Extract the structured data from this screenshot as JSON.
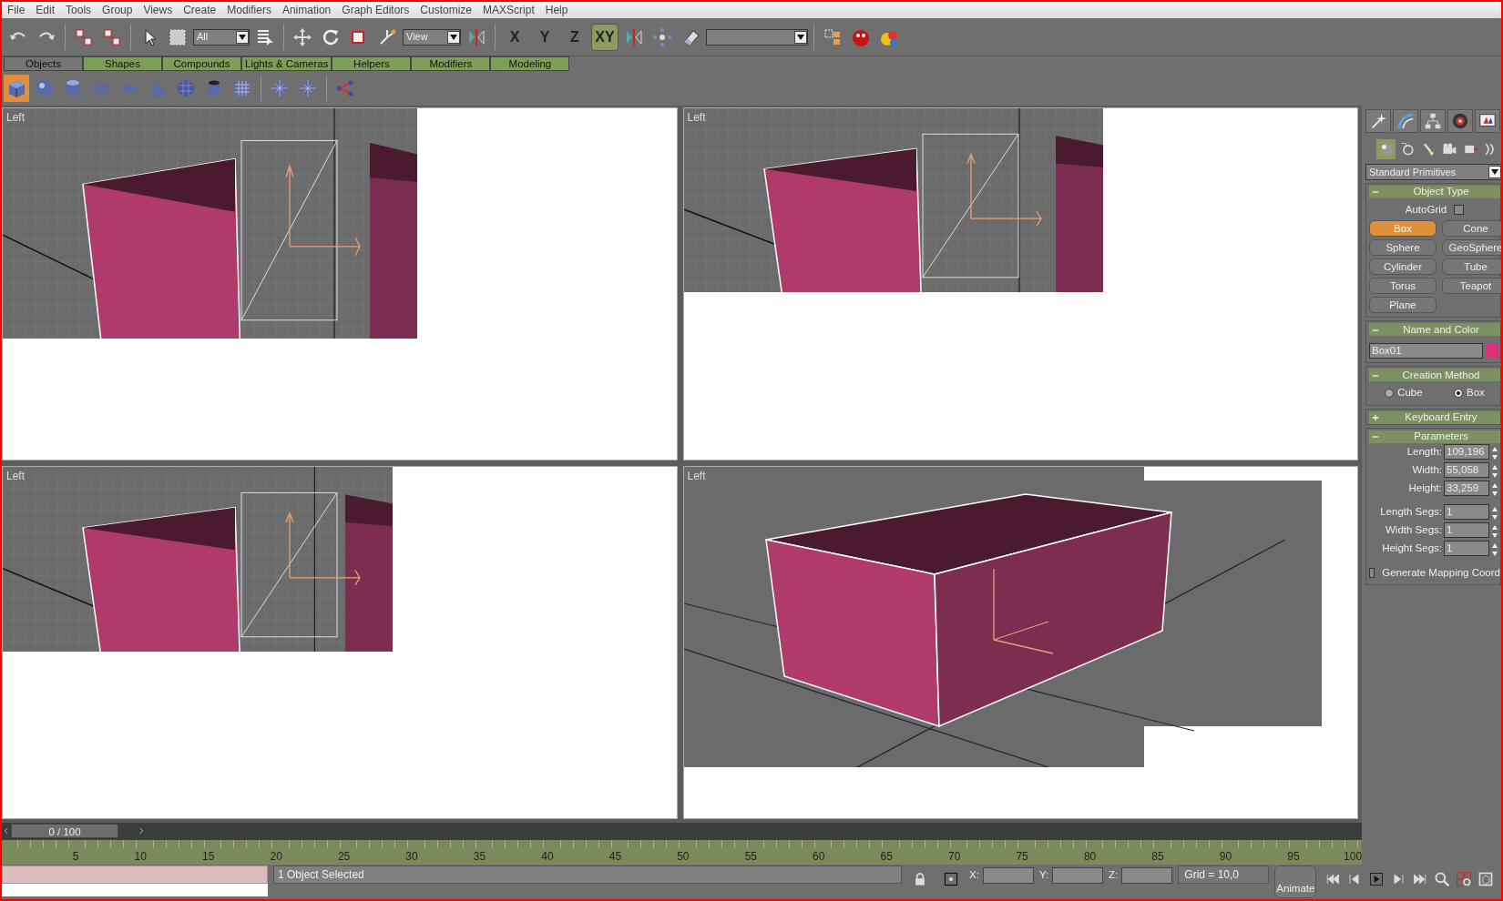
{
  "menu": [
    "File",
    "Edit",
    "Tools",
    "Group",
    "Views",
    "Create",
    "Modifiers",
    "Animation",
    "Graph Editors",
    "Customize",
    "MAXScript",
    "Help"
  ],
  "main_toolbar": {
    "selection_filter": "All",
    "reference_coord": "View",
    "axes": [
      {
        "label": "X",
        "selected": false
      },
      {
        "label": "Y",
        "selected": false
      },
      {
        "label": "Z",
        "selected": false
      },
      {
        "label": "XY",
        "selected": true
      }
    ]
  },
  "tabs": [
    {
      "label": "Objects",
      "selected": true
    },
    {
      "label": "Shapes",
      "selected": false
    },
    {
      "label": "Compounds",
      "selected": false
    },
    {
      "label": "Lights & Cameras",
      "selected": false
    },
    {
      "label": "Helpers",
      "selected": false
    },
    {
      "label": "Modifiers",
      "selected": false
    },
    {
      "label": "Modeling",
      "selected": false
    }
  ],
  "viewports": [
    {
      "label": "Left",
      "kind": "ortho"
    },
    {
      "label": "Left",
      "kind": "ortho"
    },
    {
      "label": "Left",
      "kind": "ortho"
    },
    {
      "label": "Left",
      "kind": "perspective"
    }
  ],
  "command_panel": {
    "category": "Standard Primitives",
    "rollouts": [
      {
        "title": "Object Type",
        "kind": "object_type",
        "expanded": true,
        "autogrid": {
          "label": "AutoGrid",
          "checked": false
        },
        "buttons": [
          {
            "label": "Box",
            "selected": true
          },
          {
            "label": "Cone",
            "selected": false
          },
          {
            "label": "Sphere",
            "selected": false
          },
          {
            "label": "GeoSphere",
            "selected": false
          },
          {
            "label": "Cylinder",
            "selected": false
          },
          {
            "label": "Tube",
            "selected": false
          },
          {
            "label": "Torus",
            "selected": false
          },
          {
            "label": "Teapot",
            "selected": false
          },
          {
            "label": "Plane",
            "selected": false
          }
        ]
      },
      {
        "title": "Name and Color",
        "kind": "name_color",
        "expanded": true,
        "name": "Box01",
        "color": "#e0307a"
      },
      {
        "title": "Creation Method",
        "kind": "creation",
        "expanded": true,
        "options": [
          {
            "label": "Cube",
            "selected": false
          },
          {
            "label": "Box",
            "selected": true
          }
        ]
      },
      {
        "title": "Keyboard Entry",
        "expanded": false
      },
      {
        "title": "Parameters",
        "kind": "parameters",
        "expanded": true,
        "fields": [
          {
            "label": "Length:",
            "value": "109,196"
          },
          {
            "label": "Width:",
            "value": "55,058"
          },
          {
            "label": "Height:",
            "value": "33,259"
          },
          {
            "label": "Length Segs:",
            "value": "1"
          },
          {
            "label": "Width Segs:",
            "value": "1"
          },
          {
            "label": "Height Segs:",
            "value": "1"
          }
        ],
        "mapping": {
          "label": "Generate Mapping Coord",
          "checked": false
        }
      }
    ]
  },
  "time_slider": {
    "frame": "0 / 100",
    "level": 0
  },
  "track_ticks": [
    "5",
    "10",
    "15",
    "20",
    "25",
    "30",
    "35",
    "40",
    "45",
    "50",
    "55",
    "60",
    "65",
    "70",
    "75",
    "80",
    "85",
    "90",
    "95",
    "100"
  ],
  "status_bar": {
    "selection": "1 Object Selected",
    "coords": [
      {
        "label": "X:"
      },
      {
        "label": "Y:"
      },
      {
        "label": "Z:"
      }
    ],
    "grid": "Grid = 10,0",
    "animate": "Animate"
  }
}
